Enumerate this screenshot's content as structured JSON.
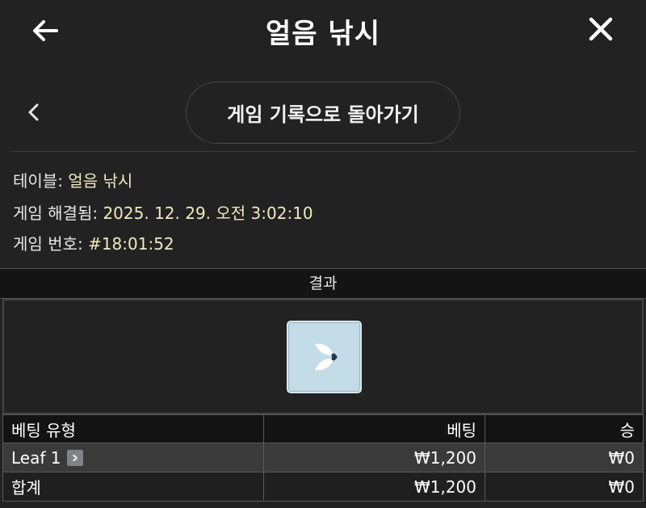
{
  "header": {
    "title": "얼음 낚시"
  },
  "nav": {
    "back_to_history": "게임 기록으로 돌아가기"
  },
  "info": {
    "table_label": "테이블: ",
    "table_value": "얼음 낚시",
    "resolved_label": "게임 해결됨: ",
    "resolved_value": "2025. 12. 29. 오전 3:02:10",
    "game_no_label": "게임 번호: ",
    "game_no_value": "#18:01:52"
  },
  "results": {
    "header": "결과",
    "card_icon": "leaf-card-icon"
  },
  "bets_table": {
    "columns": [
      "베팅 유형",
      "베팅",
      "승"
    ],
    "rows": [
      {
        "type": "Leaf 1",
        "bet": "₩1,200",
        "win": "₩0"
      }
    ],
    "total": {
      "label": "합계",
      "bet": "₩1,200",
      "win": "₩0"
    }
  },
  "colors": {
    "background": "#222222",
    "value_text": "#f1e9c0",
    "card": "#c3dce8"
  }
}
